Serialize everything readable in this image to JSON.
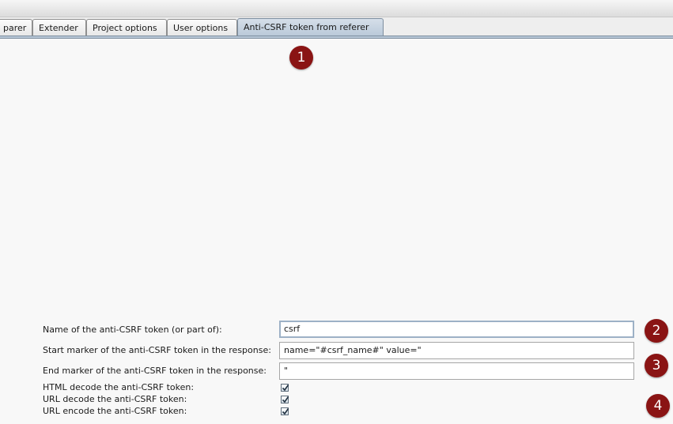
{
  "tabs": [
    {
      "label": "parer",
      "selected": false
    },
    {
      "label": "Extender",
      "selected": false
    },
    {
      "label": "Project options",
      "selected": false
    },
    {
      "label": "User options",
      "selected": false
    },
    {
      "label": "Anti-CSRF token from referer",
      "selected": true
    }
  ],
  "markers": [
    "1",
    "2",
    "3",
    "4"
  ],
  "form": {
    "token_name_label": "Name of the anti-CSRF token (or part of):",
    "token_name_value": "csrf",
    "start_marker_label": "Start marker of the anti-CSRF token in the response:",
    "start_marker_value": "name=\"#csrf_name#\" value=\"",
    "end_marker_label": "End marker of the anti-CSRF token in the response:",
    "end_marker_value": "\"",
    "html_decode_label": "HTML decode the anti-CSRF token:",
    "html_decode_checked": true,
    "url_decode_label": "URL decode the anti-CSRF token:",
    "url_decode_checked": true,
    "url_encode_label": "URL encode the anti-CSRF token:",
    "url_encode_checked": true
  },
  "colors": {
    "marker": "#8a1414",
    "selected_tab": "#b8c8d8",
    "focused_border": "#9db1c6"
  }
}
